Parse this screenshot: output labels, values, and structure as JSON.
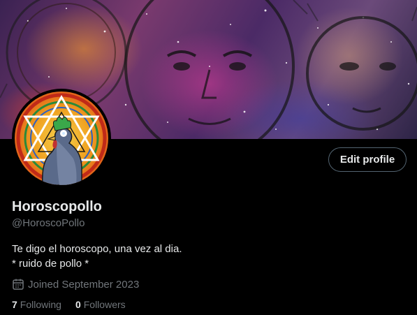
{
  "profile": {
    "display_name": "Horoscopollo",
    "handle": "@HoroscoPollo",
    "bio_line1": "Te digo el horoscopo, una vez al dia.",
    "bio_line2": "* ruido de pollo *",
    "joined": "Joined September 2023"
  },
  "actions": {
    "edit_profile_label": "Edit profile"
  },
  "stats": {
    "following_count": "7",
    "following_label": "Following",
    "followers_count": "0",
    "followers_label": "Followers"
  },
  "icons": {
    "joined": "calendar-icon"
  },
  "colors": {
    "background": "#000000",
    "primary_text": "#e7e9ea",
    "secondary_text": "#71767b",
    "button_border": "#536471"
  }
}
